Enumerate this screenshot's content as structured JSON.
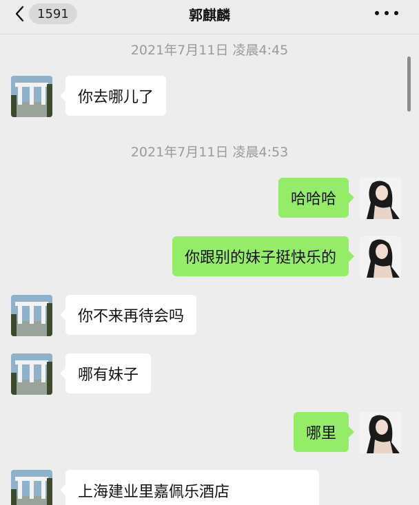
{
  "header": {
    "back_count": "1591",
    "title": "郭麒麟",
    "more_icon": "more-dots-icon"
  },
  "timestamps": [
    "2021年7月11日 凌晨4:45",
    "2021年7月11日 凌晨4:53"
  ],
  "messages": [
    {
      "side": "in",
      "text": "你去哪儿了"
    },
    {
      "side": "out",
      "text": "哈哈哈"
    },
    {
      "side": "out",
      "text": "你跟别的妹子挺快乐的"
    },
    {
      "side": "in",
      "text": "你不来再待会吗"
    },
    {
      "side": "in",
      "text": "哪有妹子"
    },
    {
      "side": "out",
      "text": "哪里"
    },
    {
      "side": "in",
      "text": "上海建业里嘉佩乐酒店"
    }
  ],
  "colors": {
    "background": "#ededed",
    "outgoing_bubble": "#95ec69",
    "incoming_bubble": "#ffffff",
    "timestamp": "#9a9a9a"
  }
}
